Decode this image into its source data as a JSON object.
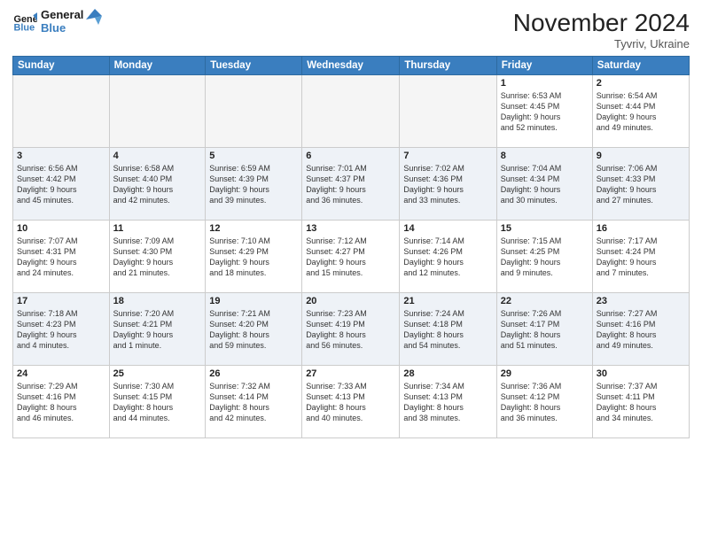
{
  "header": {
    "logo_line1": "General",
    "logo_line2": "Blue",
    "month": "November 2024",
    "location": "Tyvriv, Ukraine"
  },
  "weekdays": [
    "Sunday",
    "Monday",
    "Tuesday",
    "Wednesday",
    "Thursday",
    "Friday",
    "Saturday"
  ],
  "weeks": [
    [
      {
        "day": "",
        "info": ""
      },
      {
        "day": "",
        "info": ""
      },
      {
        "day": "",
        "info": ""
      },
      {
        "day": "",
        "info": ""
      },
      {
        "day": "",
        "info": ""
      },
      {
        "day": "1",
        "info": "Sunrise: 6:53 AM\nSunset: 4:45 PM\nDaylight: 9 hours\nand 52 minutes."
      },
      {
        "day": "2",
        "info": "Sunrise: 6:54 AM\nSunset: 4:44 PM\nDaylight: 9 hours\nand 49 minutes."
      }
    ],
    [
      {
        "day": "3",
        "info": "Sunrise: 6:56 AM\nSunset: 4:42 PM\nDaylight: 9 hours\nand 45 minutes."
      },
      {
        "day": "4",
        "info": "Sunrise: 6:58 AM\nSunset: 4:40 PM\nDaylight: 9 hours\nand 42 minutes."
      },
      {
        "day": "5",
        "info": "Sunrise: 6:59 AM\nSunset: 4:39 PM\nDaylight: 9 hours\nand 39 minutes."
      },
      {
        "day": "6",
        "info": "Sunrise: 7:01 AM\nSunset: 4:37 PM\nDaylight: 9 hours\nand 36 minutes."
      },
      {
        "day": "7",
        "info": "Sunrise: 7:02 AM\nSunset: 4:36 PM\nDaylight: 9 hours\nand 33 minutes."
      },
      {
        "day": "8",
        "info": "Sunrise: 7:04 AM\nSunset: 4:34 PM\nDaylight: 9 hours\nand 30 minutes."
      },
      {
        "day": "9",
        "info": "Sunrise: 7:06 AM\nSunset: 4:33 PM\nDaylight: 9 hours\nand 27 minutes."
      }
    ],
    [
      {
        "day": "10",
        "info": "Sunrise: 7:07 AM\nSunset: 4:31 PM\nDaylight: 9 hours\nand 24 minutes."
      },
      {
        "day": "11",
        "info": "Sunrise: 7:09 AM\nSunset: 4:30 PM\nDaylight: 9 hours\nand 21 minutes."
      },
      {
        "day": "12",
        "info": "Sunrise: 7:10 AM\nSunset: 4:29 PM\nDaylight: 9 hours\nand 18 minutes."
      },
      {
        "day": "13",
        "info": "Sunrise: 7:12 AM\nSunset: 4:27 PM\nDaylight: 9 hours\nand 15 minutes."
      },
      {
        "day": "14",
        "info": "Sunrise: 7:14 AM\nSunset: 4:26 PM\nDaylight: 9 hours\nand 12 minutes."
      },
      {
        "day": "15",
        "info": "Sunrise: 7:15 AM\nSunset: 4:25 PM\nDaylight: 9 hours\nand 9 minutes."
      },
      {
        "day": "16",
        "info": "Sunrise: 7:17 AM\nSunset: 4:24 PM\nDaylight: 9 hours\nand 7 minutes."
      }
    ],
    [
      {
        "day": "17",
        "info": "Sunrise: 7:18 AM\nSunset: 4:23 PM\nDaylight: 9 hours\nand 4 minutes."
      },
      {
        "day": "18",
        "info": "Sunrise: 7:20 AM\nSunset: 4:21 PM\nDaylight: 9 hours\nand 1 minute."
      },
      {
        "day": "19",
        "info": "Sunrise: 7:21 AM\nSunset: 4:20 PM\nDaylight: 8 hours\nand 59 minutes."
      },
      {
        "day": "20",
        "info": "Sunrise: 7:23 AM\nSunset: 4:19 PM\nDaylight: 8 hours\nand 56 minutes."
      },
      {
        "day": "21",
        "info": "Sunrise: 7:24 AM\nSunset: 4:18 PM\nDaylight: 8 hours\nand 54 minutes."
      },
      {
        "day": "22",
        "info": "Sunrise: 7:26 AM\nSunset: 4:17 PM\nDaylight: 8 hours\nand 51 minutes."
      },
      {
        "day": "23",
        "info": "Sunrise: 7:27 AM\nSunset: 4:16 PM\nDaylight: 8 hours\nand 49 minutes."
      }
    ],
    [
      {
        "day": "24",
        "info": "Sunrise: 7:29 AM\nSunset: 4:16 PM\nDaylight: 8 hours\nand 46 minutes."
      },
      {
        "day": "25",
        "info": "Sunrise: 7:30 AM\nSunset: 4:15 PM\nDaylight: 8 hours\nand 44 minutes."
      },
      {
        "day": "26",
        "info": "Sunrise: 7:32 AM\nSunset: 4:14 PM\nDaylight: 8 hours\nand 42 minutes."
      },
      {
        "day": "27",
        "info": "Sunrise: 7:33 AM\nSunset: 4:13 PM\nDaylight: 8 hours\nand 40 minutes."
      },
      {
        "day": "28",
        "info": "Sunrise: 7:34 AM\nSunset: 4:13 PM\nDaylight: 8 hours\nand 38 minutes."
      },
      {
        "day": "29",
        "info": "Sunrise: 7:36 AM\nSunset: 4:12 PM\nDaylight: 8 hours\nand 36 minutes."
      },
      {
        "day": "30",
        "info": "Sunrise: 7:37 AM\nSunset: 4:11 PM\nDaylight: 8 hours\nand 34 minutes."
      }
    ]
  ]
}
